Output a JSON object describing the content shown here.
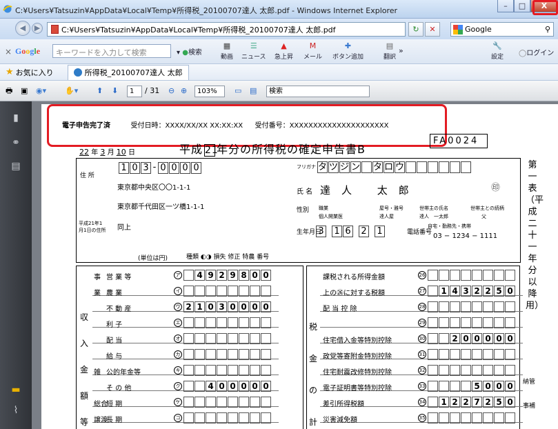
{
  "window": {
    "title": "C:¥Users¥Tatsuzin¥AppData¥Local¥Temp¥所得税_20100707達人 太郎.pdf - Windows Internet Explorer",
    "min": "–",
    "max": "□",
    "close": "X"
  },
  "address": {
    "url": "C:¥Users¥Tatsuzin¥AppData¥Local¥Temp¥所得税_20100707達人 太郎.pdf",
    "refresh": "↻",
    "stop": "✕"
  },
  "search": {
    "engine": "Google"
  },
  "google_toolbar": {
    "placeholder": "キーワードを入力して検索",
    "search_label": "検索",
    "buttons": [
      "動画",
      "ニュース",
      "急上昇",
      "メール",
      "ボタン追加",
      "翻訳",
      "設定"
    ],
    "login": "ログイン"
  },
  "favorites": {
    "label": "お気に入り",
    "tab": "所得税_20100707達人 太郎"
  },
  "pdf_toolbar": {
    "page": "1",
    "total": "/ 31",
    "zoom": "103%",
    "search": "検索"
  },
  "form": {
    "stamp_title": "電子申告完了済",
    "received_at": "受付日時：XXXX/XX/XX XX:XX:XX",
    "received_no": "受付番号：XXXXXXXXXXXXXXXXXXXXX",
    "form_id": "FA0024",
    "date_text": [
      "22",
      "年",
      "3",
      "月",
      "10",
      "日"
    ],
    "title_pre": "平成",
    "title_year": "21",
    "title_post": "年分の所得税の確定申告書B",
    "side_vertical": "第一表（平成二十一年分以降用）",
    "postal": [
      "1",
      "0",
      "3",
      "-",
      "0",
      "0",
      "0",
      "0"
    ],
    "address_label": "住 所",
    "address1": "東京都中央区〇〇1-1-1",
    "address2": "東京都千代田区一ツ橋1-1-1",
    "address3_label": "平成21年1月1日の住所",
    "address3": "同上",
    "furigana_label": "フリガナ",
    "furigana": [
      "タ",
      "ツ",
      "ジ",
      "ン",
      "",
      "タ",
      "ロ",
      "ウ"
    ],
    "name_label": "氏 名",
    "name": "達人 太郎",
    "seal": "㊞",
    "gender_label": "性別",
    "occupation_label": "職業",
    "occupation": "個人開業医",
    "yago_label": "屋号・雅号",
    "yago": "達人屋",
    "householder_label": "世帯主の氏名",
    "householder": "達人　一太郎",
    "relation_label": "世帯主との続柄",
    "relation": "父",
    "birth_label": "生年月日",
    "birth": [
      "3",
      "1",
      "6",
      "2",
      "1"
    ],
    "phone_label": "電話番号",
    "phone_type": "自宅・勤務先・携帯",
    "phone": "03 − 1234 − 1111",
    "unit": "(単位は円)",
    "income_rows": [
      {
        "cat": "事",
        "label": "営 業 等",
        "mark": "ア",
        "value": "4929800"
      },
      {
        "cat": "業",
        "label": "農 業",
        "mark": "イ",
        "value": ""
      },
      {
        "cat": "",
        "label": "不 動 産",
        "mark": "ウ",
        "value": "21030000"
      },
      {
        "cat": "",
        "label": "利 子",
        "mark": "エ",
        "value": ""
      },
      {
        "cat": "",
        "label": "配 当",
        "mark": "オ",
        "value": ""
      },
      {
        "cat": "",
        "label": "給 与",
        "mark": "カ",
        "value": ""
      },
      {
        "cat": "雑",
        "label": "公的年金等",
        "mark": "キ",
        "value": ""
      },
      {
        "cat": "",
        "label": "そ の 他",
        "mark": "ク",
        "value": "400000"
      },
      {
        "cat": "総合",
        "label": "短 期",
        "mark": "ケ",
        "value": ""
      },
      {
        "cat": "譲渡",
        "label": "長 期",
        "mark": "コ",
        "value": ""
      }
    ],
    "income_side": [
      "収",
      "入",
      "金",
      "額",
      "等"
    ],
    "tax_rows": [
      {
        "label": "課税される所得金額",
        "mark": "26",
        "value": ""
      },
      {
        "label": "上の㉖に対する税額",
        "mark": "27",
        "value": "1432250"
      },
      {
        "label": "配 当 控 除",
        "mark": "28",
        "value": ""
      },
      {
        "label": "",
        "mark": "29",
        "value": ""
      },
      {
        "label": "住宅借入金等特別控除",
        "mark": "30",
        "value": "200000"
      },
      {
        "label": "政党等寄附金特別控除",
        "mark": "31",
        "value": ""
      },
      {
        "label": "住宅耐震改修特別控除",
        "mark": "32",
        "value": ""
      },
      {
        "label": "電子証明書等特別控除",
        "mark": "33",
        "value": "5000"
      },
      {
        "label": "差引所得税額",
        "mark": "34",
        "value": "1227250"
      },
      {
        "label": "災害減免額",
        "mark": "35",
        "value": ""
      }
    ],
    "tax_side": [
      "税",
      "金",
      "の",
      "計"
    ],
    "extra_labels": [
      "種類",
      "損失",
      "修正",
      "特農",
      "番号"
    ],
    "right_labels": [
      "納管",
      "事補"
    ]
  }
}
